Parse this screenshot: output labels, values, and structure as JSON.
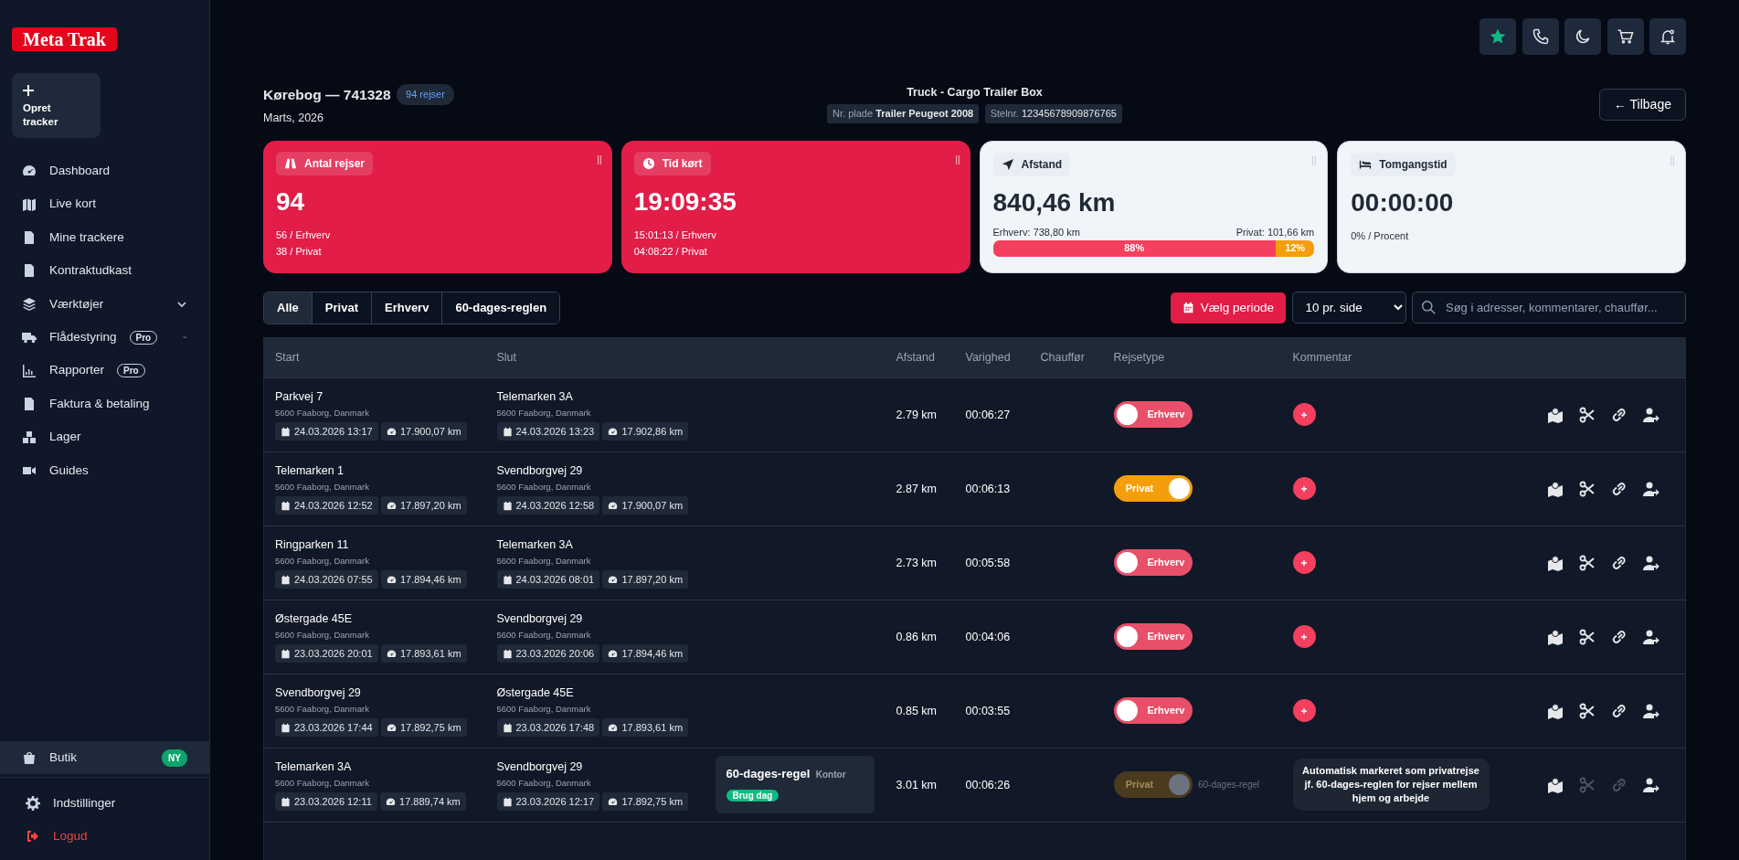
{
  "sidebar": {
    "logo": "Meta Trak",
    "create_button": "Opret tracker",
    "items": [
      {
        "label": "Dashboard",
        "expandable": false
      },
      {
        "label": "Live kort",
        "expandable": false
      },
      {
        "label": "Mine trackere",
        "expandable": false
      },
      {
        "label": "Kontraktudkast",
        "expandable": false
      },
      {
        "label": "Værktøjer",
        "expandable": true
      },
      {
        "label": "Flådestyring",
        "badge": "Pro",
        "expandable": true
      },
      {
        "label": "Rapporter",
        "badge": "Pro",
        "expandable": false
      },
      {
        "label": "Faktura & betaling",
        "expandable": false
      },
      {
        "label": "Lager",
        "expandable": false
      },
      {
        "label": "Guides",
        "expandable": false
      }
    ],
    "shop": {
      "label": "Butik",
      "badge": "NY",
      "selected": true
    },
    "bottom_items": [
      {
        "label": "Indstillinger",
        "kind": "normal"
      },
      {
        "label": "Logud",
        "kind": "danger"
      }
    ]
  },
  "header": {
    "title": "Kørebog — 741328",
    "count_badge": "94 rejser",
    "subtitle": "Marts, 2026",
    "vehicle": {
      "name": "Truck - Cargo Trailer Box",
      "plate_label": "Nr. plade",
      "plate": "Trailer Peugeot 2008",
      "vin_label": "Stelnr.",
      "vin": "12345678909876765"
    },
    "back_button": "← Tilbage"
  },
  "stat_cards": [
    {
      "label": "Antal rejser",
      "value": "94",
      "highlighted": true,
      "lines": [
        "56 / Erhverv",
        "38 / Privat"
      ]
    },
    {
      "label": "Tid kørt",
      "value": "19:09:35",
      "highlighted": true,
      "lines": [
        "15:01:13 / Erhverv",
        "04:08:22 / Privat"
      ]
    },
    {
      "label": "Afstand",
      "value": "840,46 km",
      "highlighted": false,
      "split": {
        "left": "Erhverv: 738,80 km",
        "right": "Privat: 101,66 km",
        "level": 0.88,
        "left_percent": "88%",
        "right_percent": "12%"
      }
    },
    {
      "label": "Tomgangstid",
      "value": "00:00:00",
      "highlighted": false,
      "lines": [
        "0% / Procent"
      ]
    }
  ],
  "filters": [
    {
      "label": "Alle",
      "selected": true
    },
    {
      "label": "Privat",
      "selected": false
    },
    {
      "label": "Erhverv",
      "selected": false
    },
    {
      "label": "60-dages-reglen",
      "selected": false
    }
  ],
  "period_button": "Vælg periode",
  "page_size": "10 pr. side",
  "search": {
    "placeholder": "Søg i adresser, kommentarer, chauffør..."
  },
  "table": {
    "columns": [
      "Start",
      "Slut",
      "Afstand",
      "Varighed",
      "Chauffør",
      "Rejsetype",
      "Kommentar"
    ],
    "rows": [
      {
        "start": {
          "address": "Parkvej 7",
          "city": "5600 Faaborg, Danmark",
          "time": "24.03.2026 13:17",
          "odometer": "17.900,07 km"
        },
        "end": {
          "address": "Telemarken 3A",
          "city": "5600 Faaborg, Danmark",
          "time": "24.03.2026 13:23",
          "odometer": "17.902,86 km"
        },
        "distance": "2.79 km",
        "duration": "00:06:27",
        "trip_type": {
          "label": "Erhverv",
          "private": false
        },
        "locked": false
      },
      {
        "start": {
          "address": "Telemarken 1",
          "city": "5600 Faaborg, Danmark",
          "time": "24.03.2026 12:52",
          "odometer": "17.897,20 km"
        },
        "end": {
          "address": "Svendborgvej 29",
          "city": "5600 Faaborg, Danmark",
          "time": "24.03.2026 12:58",
          "odometer": "17.900,07 km"
        },
        "distance": "2.87 km",
        "duration": "00:06:13",
        "trip_type": {
          "label": "Privat",
          "private": true
        },
        "locked": false
      },
      {
        "start": {
          "address": "Ringparken 11",
          "city": "5600 Faaborg, Danmark",
          "time": "24.03.2026 07:55",
          "odometer": "17.894,46 km"
        },
        "end": {
          "address": "Telemarken 3A",
          "city": "5600 Faaborg, Danmark",
          "time": "24.03.2026 08:01",
          "odometer": "17.897,20 km"
        },
        "distance": "2.73 km",
        "duration": "00:05:58",
        "trip_type": {
          "label": "Erhverv",
          "private": false
        },
        "locked": false
      },
      {
        "start": {
          "address": "Østergade 45E",
          "city": "5600 Faaborg, Danmark",
          "time": "23.03.2026 20:01",
          "odometer": "17.893,61 km"
        },
        "end": {
          "address": "Svendborgvej 29",
          "city": "5600 Faaborg, Danmark",
          "time": "23.03.2026 20:06",
          "odometer": "17.894,46 km"
        },
        "distance": "0.86 km",
        "duration": "00:04:06",
        "trip_type": {
          "label": "Erhverv",
          "private": false
        },
        "locked": false
      },
      {
        "start": {
          "address": "Svendborgvej 29",
          "city": "5600 Faaborg, Danmark",
          "time": "23.03.2026 17:44",
          "odometer": "17.892,75 km"
        },
        "end": {
          "address": "Østergade 45E",
          "city": "5600 Faaborg, Danmark",
          "time": "23.03.2026 17:48",
          "odometer": "17.893,61 km"
        },
        "distance": "0.85 km",
        "duration": "00:03:55",
        "trip_type": {
          "label": "Erhverv",
          "private": false
        },
        "locked": false
      },
      {
        "start": {
          "address": "Telemarken 3A",
          "city": "5600 Faaborg, Danmark",
          "time": "23.03.2026 12:11",
          "odometer": "17.889,74 km"
        },
        "end": {
          "address": "Svendborgvej 29",
          "city": "5600 Faaborg, Danmark",
          "time": "23.03.2026 12:17",
          "odometer": "17.892,75 km"
        },
        "rule": {
          "title": "60-dages-regel",
          "tag": "Kontor",
          "badge": "Brug dag"
        },
        "distance": "3.01 km",
        "duration": "00:06:26",
        "trip_type": {
          "label": "Privat",
          "private": true
        },
        "locked": true,
        "rule_note": "60-dages-regel",
        "comment": "Automatisk markeret som privatrejse jf. 60-dages-reglen for rejser mellem hjem og arbejde"
      }
    ]
  }
}
